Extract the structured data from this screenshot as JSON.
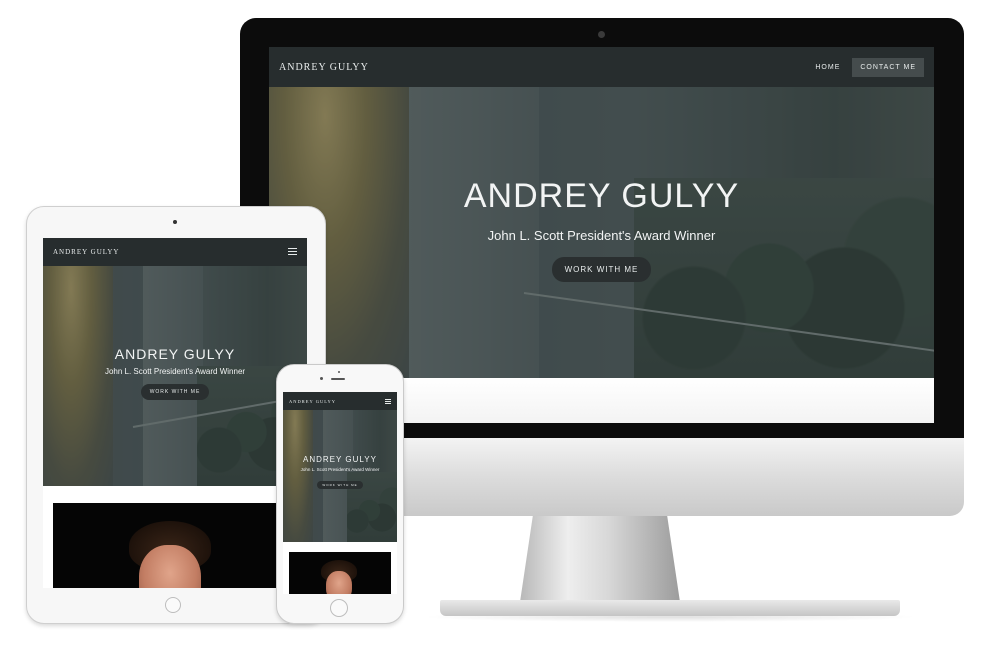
{
  "site": {
    "brand": "ANDREY GULYY",
    "nav": {
      "home": "HOME",
      "contact": "CONTACT ME"
    },
    "hero": {
      "title": "ANDREY GULYY",
      "subtitle": "John L. Scott President's Award Winner",
      "cta": "WORK WITH ME"
    }
  },
  "icons": {
    "menu": "hamburger-menu-icon",
    "camera": "camera-icon",
    "home_button": "home-button-icon"
  },
  "colors": {
    "nav_bg": "#272d2e",
    "cta_bg": "#2a2f30",
    "contact_bg": "#454c4d",
    "bezel": "#0c0c0c"
  }
}
